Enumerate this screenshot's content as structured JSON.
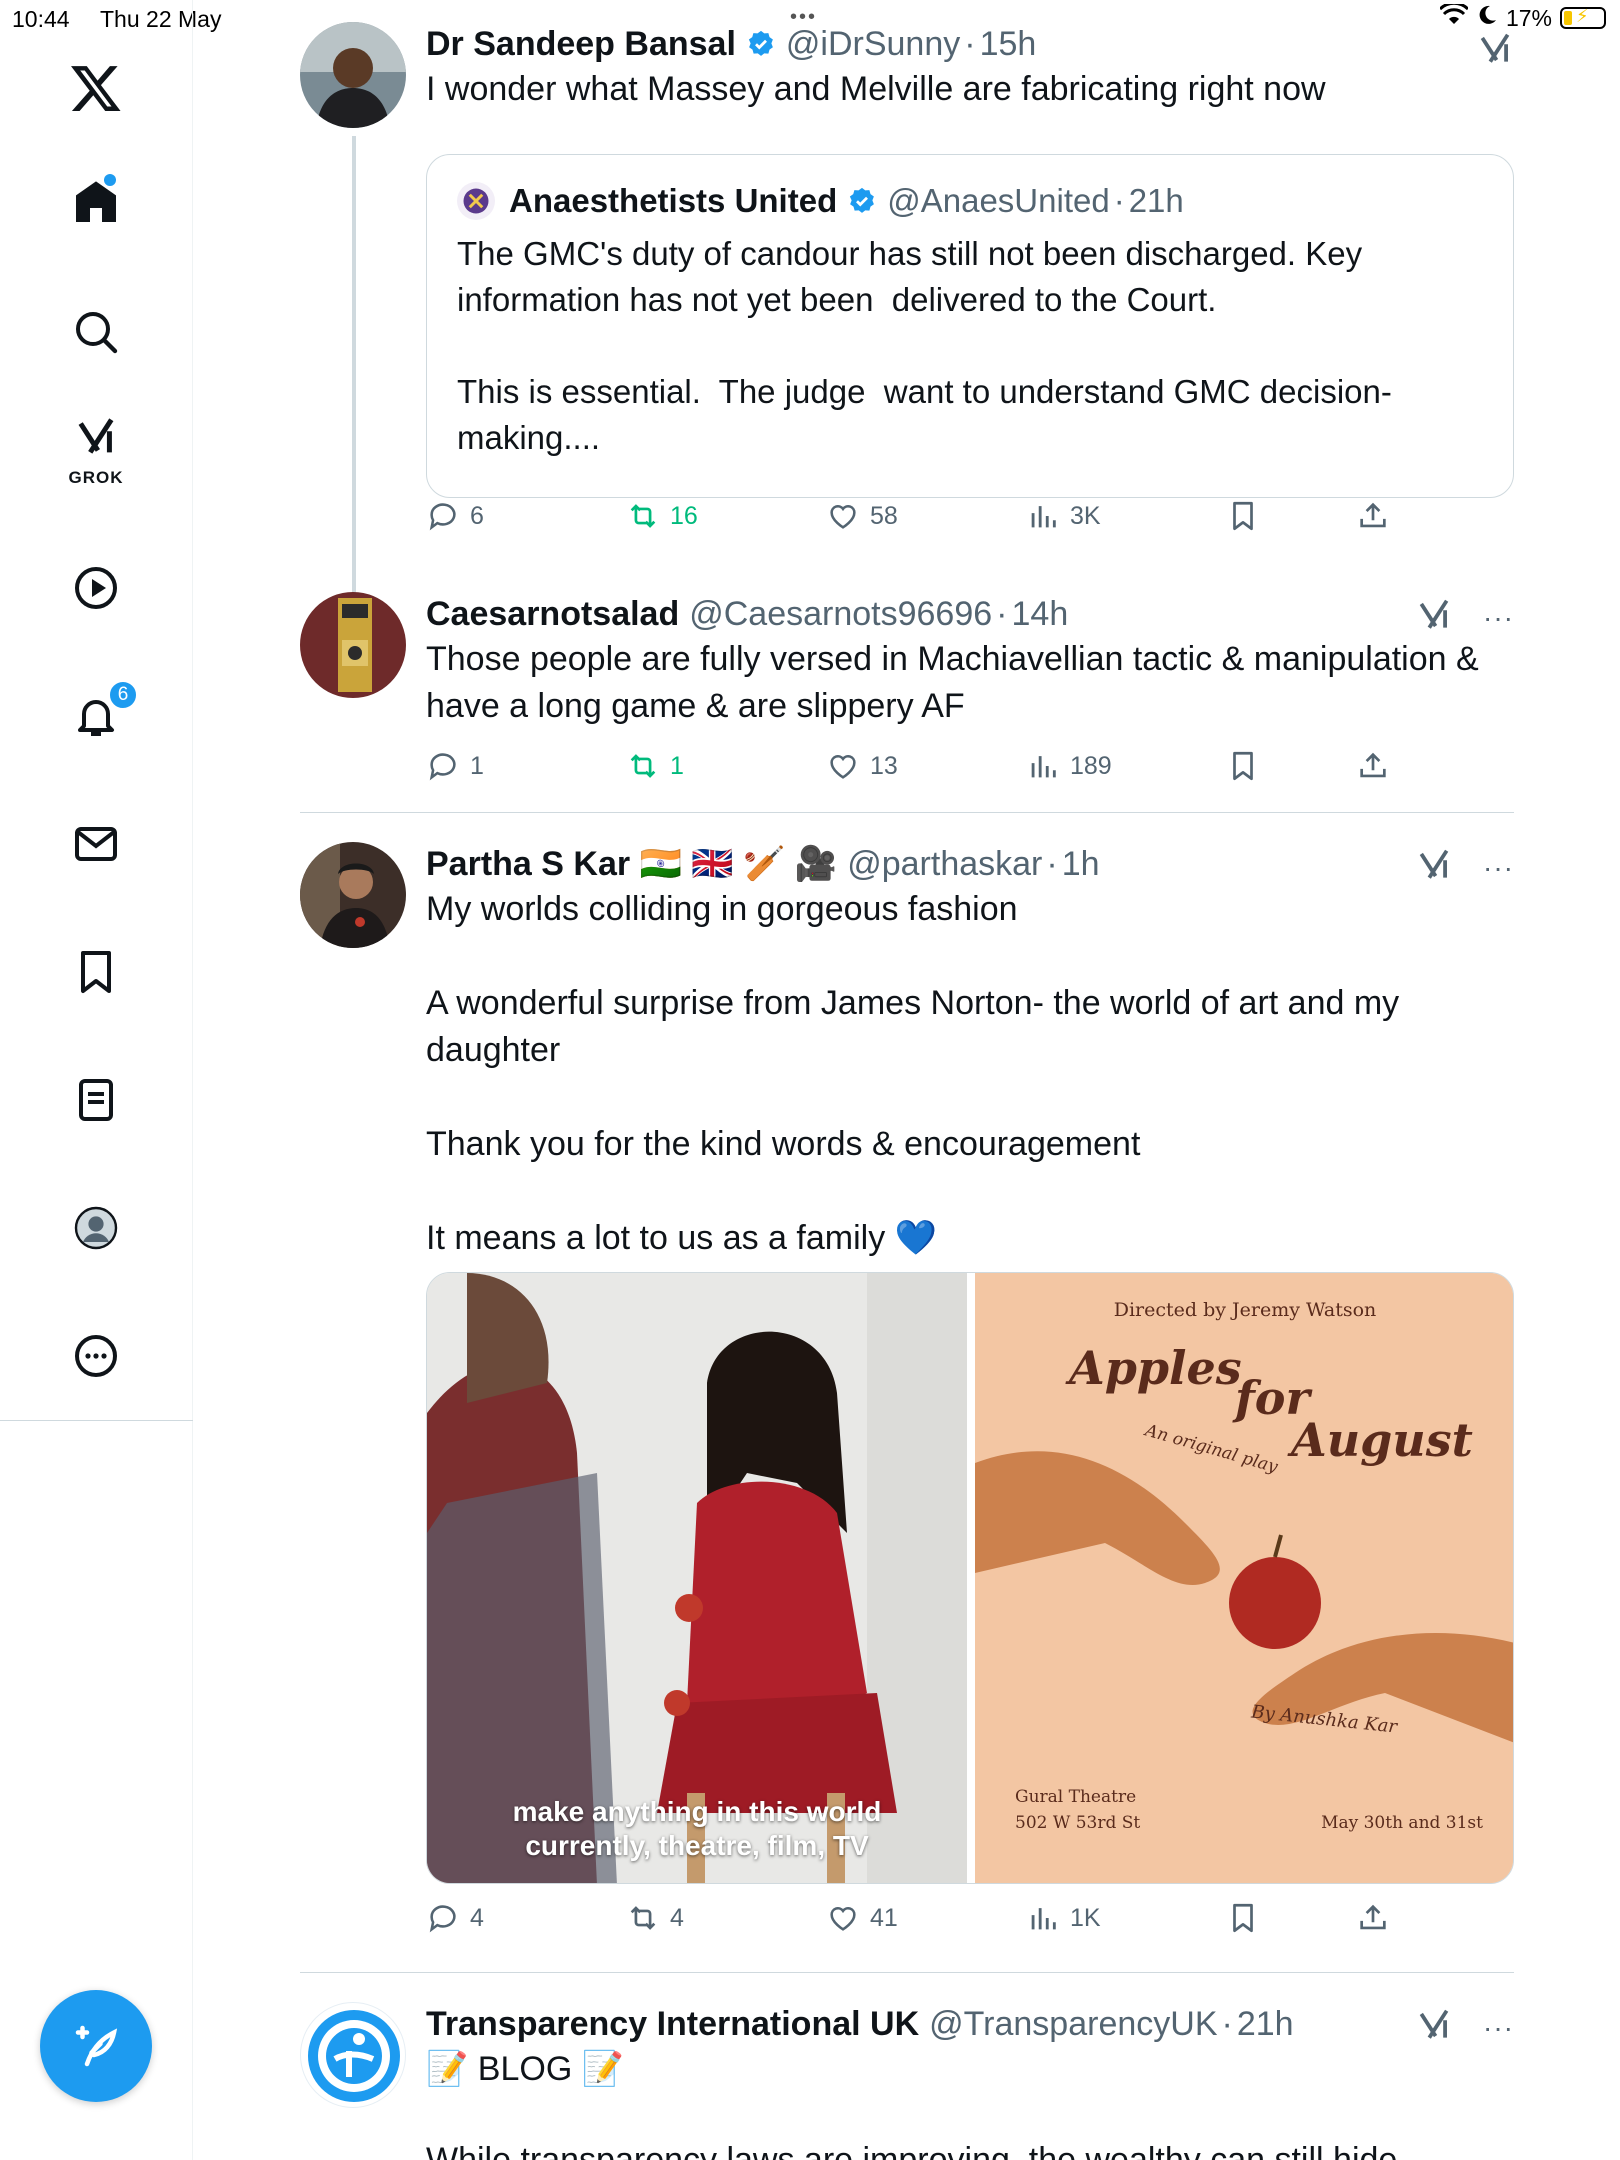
{
  "status_bar": {
    "time": "10:44",
    "date": "Thu 22 May",
    "battery": "17%"
  },
  "nav": {
    "grok_label": "GROK",
    "notifications_badge": "6",
    "accent_color": "#1d9bf0"
  },
  "tweets": [
    {
      "name": "Dr Sandeep Bansal",
      "handle": "@iDrSunny",
      "sep": "·",
      "time": "15h",
      "verified": true,
      "text": "I wonder what Massey and Melville are fabricating right now",
      "quote": {
        "name": "Anaesthetists United",
        "handle": "@AnaesUnited",
        "sep": "·",
        "time": "21h",
        "verified": true,
        "text": "The GMC's duty of candour has still not been discharged. Key information has not yet been  delivered to the Court.\n\nThis is essential.  The judge  want to understand GMC decision-making...."
      },
      "replies": "6",
      "reposts": "16",
      "likes": "58",
      "views": "3K"
    },
    {
      "name": "Caesarnotsalad",
      "handle": "@Caesarnots96696",
      "sep": "·",
      "time": "14h",
      "text": "Those people are fully versed in Machiavellian tactic & manipulation & have a long game & are slippery AF",
      "replies": "1",
      "reposts": "1",
      "likes": "13",
      "views": "189"
    },
    {
      "name": "Partha S Kar 🇮🇳 🇬🇧 🏏 🎥",
      "handle": "@parthaskar",
      "sep": "·",
      "time": "1h",
      "text": "My worlds colliding in gorgeous fashion\n\nA wonderful surprise from James Norton- the world of art and my daughter\n\nThank you for the kind words & encouragement\n\nIt means a lot to us as a family 💙",
      "media": {
        "caption_line1": "make anything in this world",
        "caption_line2": "currently, theatre, film, TV",
        "poster": {
          "directed_by": "Directed by Jeremy Watson",
          "title_1": "Apples",
          "title_2": "for",
          "title_3": "August",
          "subtitle": "An original play",
          "author": "By Anushka Kar",
          "venue_1": "Gural Theatre",
          "venue_2": "502 W 53rd St",
          "dates": "May 30th and 31st"
        }
      },
      "replies": "4",
      "reposts": "4",
      "likes": "41",
      "views": "1K"
    },
    {
      "name": "Transparency International UK",
      "handle": "@TransparencyUK",
      "sep": "·",
      "time": "21h",
      "text": "📝 BLOG 📝",
      "text_partial": "While transparency laws are improving, the wealthy can still hide"
    }
  ]
}
